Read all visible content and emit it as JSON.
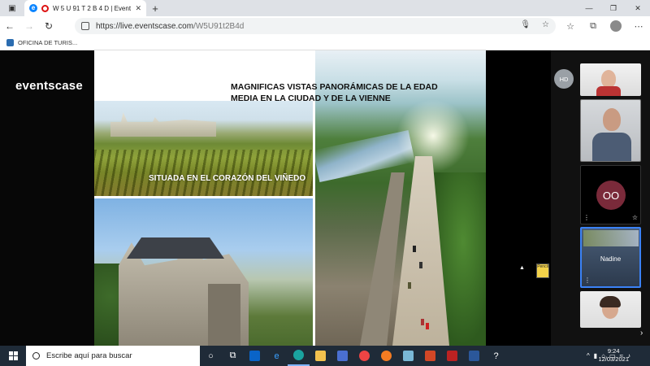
{
  "browser": {
    "tab_title": "W 5 U 91 T 2 B 4 D | Events",
    "url_host": "https://live.eventscase.com",
    "url_path": "/W5U91t2B4d",
    "favorite_label": "OFICINA DE TURIS..."
  },
  "app": {
    "brand": "eventscase"
  },
  "slide": {
    "title_line1": "MAGNIFICAS VISTAS PANORÁMICAS DE LA EDAD",
    "title_line2": "MEDIA EN LA CIUDAD Y DE LA VIENNE",
    "caption": "SITUADA EN EL CORAZÓN DEL VIÑEDO"
  },
  "participants": {
    "self_initials": "HD",
    "oo_initials": "OO",
    "nadine_label": "Nadine"
  },
  "sticker": {
    "label": "Pencil"
  },
  "taskbar": {
    "search_placeholder": "Escribe aquí para buscar",
    "time": "9:24",
    "date": "12/03/2021"
  }
}
